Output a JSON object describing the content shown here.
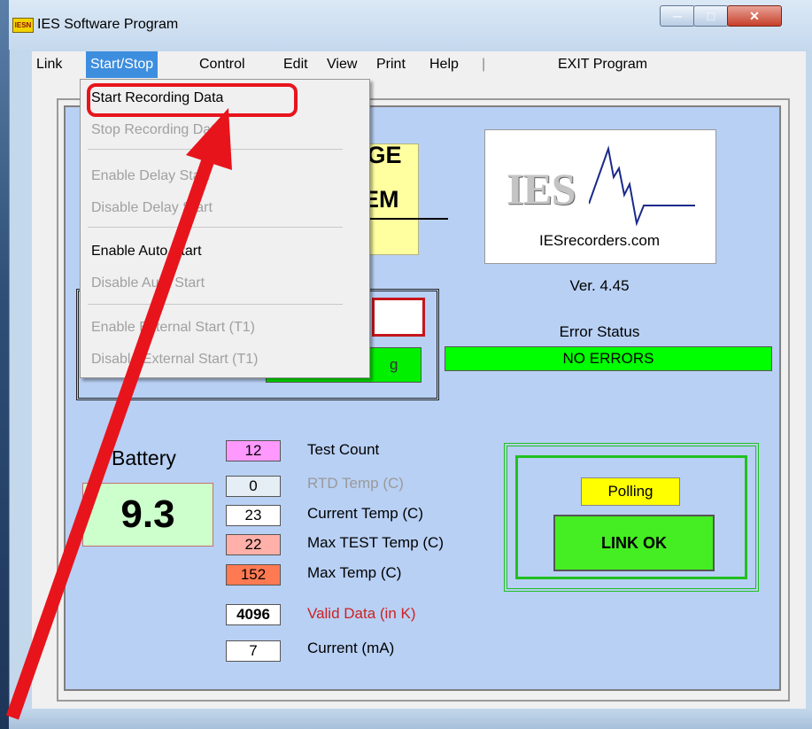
{
  "window": {
    "title": "IES Software Program",
    "icon_text": "IESN"
  },
  "menubar": {
    "items": [
      "Link",
      "Start/Stop",
      "Control",
      "Edit",
      "View",
      "Print",
      "Help",
      "|",
      "EXIT Program"
    ]
  },
  "dropdown": {
    "items": [
      {
        "label": "Start Recording Data",
        "enabled": true
      },
      {
        "label": "Stop Recording Data",
        "enabled": false
      },
      {
        "label": "Enable Delay Start",
        "enabled": false
      },
      {
        "label": "Disable Delay Start",
        "enabled": false
      },
      {
        "label": "Enable Auto Start",
        "enabled": true
      },
      {
        "label": "Disable Auto Start",
        "enabled": false
      },
      {
        "label": "Enable External Start (T1)",
        "enabled": false
      },
      {
        "label": "Disable External Start (T1)",
        "enabled": false
      }
    ]
  },
  "title_fragment": {
    "line1": "UGE",
    "line2": "EM"
  },
  "logo": {
    "text": "IES",
    "url": "IESrecorders.com"
  },
  "version": "Ver. 4.45",
  "error": {
    "label": "Error Status",
    "value": "NO ERRORS"
  },
  "status_fragment": "g",
  "battery": {
    "label": "Battery",
    "value": "9.3"
  },
  "readings": [
    {
      "value": "12",
      "label": "Test Count",
      "bg": "#ff99ff",
      "label_color": "#000000"
    },
    {
      "value": "0",
      "label": "RTD Temp (C)",
      "bg": "#e4eef4",
      "label_color": "#9a9a9a"
    },
    {
      "value": "23",
      "label": "Current Temp (C)",
      "bg": "#ffffff",
      "label_color": "#000000"
    },
    {
      "value": "22",
      "label": "Max TEST Temp (C)",
      "bg": "#ffb0a8",
      "label_color": "#000000"
    },
    {
      "value": "152",
      "label": "Max Temp (C)",
      "bg": "#ff7a52",
      "label_color": "#000000"
    },
    {
      "value": "4096",
      "label": "Valid Data (in K)",
      "bg": "#ffffff",
      "label_color": "#cc2222"
    },
    {
      "value": "7",
      "label": "Current (mA)",
      "bg": "#ffffff",
      "label_color": "#000000"
    }
  ],
  "link": {
    "polling": "Polling",
    "status": "LINK OK"
  },
  "colors": {
    "accent_annotation": "#e8141c",
    "menu_highlight": "#3d8ede"
  }
}
